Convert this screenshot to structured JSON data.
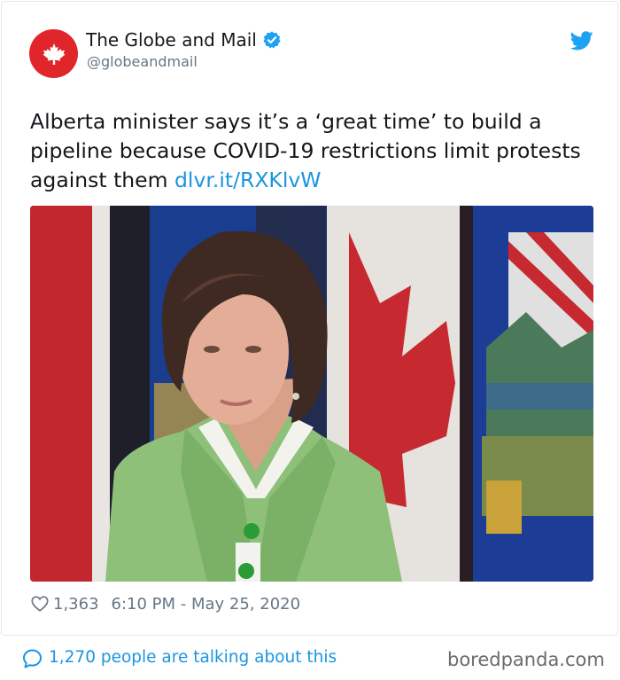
{
  "author": {
    "name": "The Globe and Mail",
    "handle": "@globeandmail",
    "verified": true,
    "avatar_icon": "maple-leaf-icon",
    "avatar_color": "#e1262b"
  },
  "tweet": {
    "text": "Alberta minister says it’s a ‘great time’ to build a pipeline because COVID-19 restrictions limit protests against them ",
    "link": "dlvr.it/RXKlvW",
    "likes": "1,363",
    "timestamp": "6:10 PM - May 25, 2020"
  },
  "photo": {
    "icon": "news-photo"
  },
  "footer": {
    "talking": "1,270 people are talking about this",
    "watermark": "boredpanda.com"
  },
  "colors": {
    "link": "#1b95e0",
    "secondary_text": "#657786",
    "verified": "#1da1f2"
  }
}
